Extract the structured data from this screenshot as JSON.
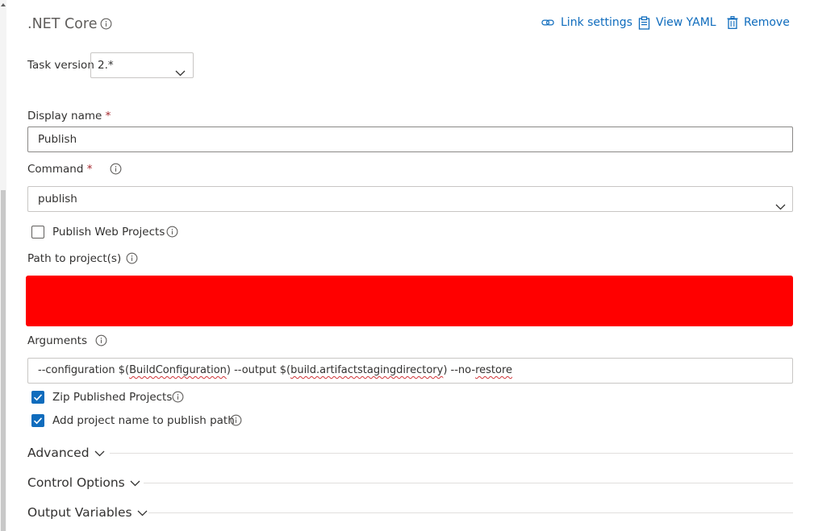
{
  "task": {
    "title": ".NET Core",
    "actions": {
      "link_settings": "Link settings",
      "view_yaml": "View YAML",
      "remove": "Remove"
    }
  },
  "task_version": {
    "label": "Task version",
    "value": "2.*"
  },
  "display_name": {
    "label": "Display name",
    "required_mark": "*",
    "value": "Publish"
  },
  "command": {
    "label": "Command",
    "required_mark": "*",
    "value": "publish"
  },
  "publish_web_projects": {
    "label": "Publish Web Projects",
    "checked": false
  },
  "path_to_projects": {
    "label": "Path to project(s)"
  },
  "arguments": {
    "label": "Arguments",
    "parts": {
      "p1": "--configuration $(",
      "p2": "BuildConfiguration",
      "p3": ") --output $(",
      "p4": "build.artifactstagingdirectory",
      "p5": ") --no-",
      "p6": "restore"
    }
  },
  "zip_published": {
    "label": "Zip Published Projects",
    "checked": true
  },
  "add_project_name": {
    "label": "Add project name to publish path",
    "checked": true
  },
  "sections": {
    "advanced": "Advanced",
    "control_options": "Control Options",
    "output_variables": "Output Variables"
  },
  "colors": {
    "accent": "#0f6cbd",
    "redacted": "#ff0000",
    "required": "#a4262c"
  }
}
